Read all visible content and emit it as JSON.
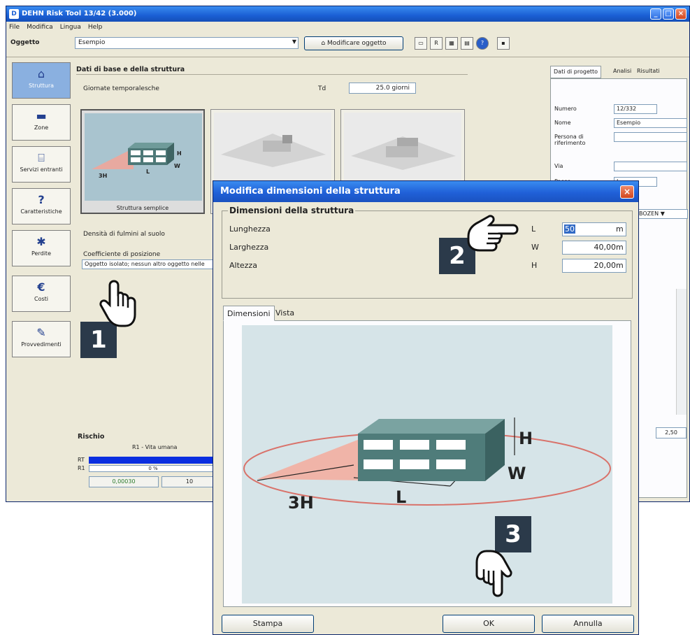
{
  "main_window": {
    "title": "DEHN Risk Tool 13/42 (3.000)",
    "menu": [
      "File",
      "Modifica",
      "Lingua",
      "Help"
    ],
    "object_label": "Oggetto",
    "object_value": "Esempio",
    "modify_object_button": "Modificare oggetto",
    "toolbar_icons": [
      "new-object-icon",
      "re-icon",
      "table-icon",
      "chart-icon",
      "help-icon",
      "save-icon"
    ]
  },
  "sidebar": {
    "items": [
      {
        "label": "Struttura",
        "icon": "building-icon",
        "active": true
      },
      {
        "label": "Zone",
        "icon": "zone-icon"
      },
      {
        "label": "Servizi entranti",
        "icon": "services-icon"
      },
      {
        "label": "Caratteristiche",
        "icon": "question-icon"
      },
      {
        "label": "Perdite",
        "icon": "loss-icon"
      },
      {
        "label": "Costi",
        "icon": "euro-icon"
      },
      {
        "label": "Provvedimenti",
        "icon": "wrench-icon"
      }
    ]
  },
  "base_data": {
    "title": "Dati di base e della struttura",
    "thunderstorm_label": "Giornate temporalesche",
    "td_label": "Td",
    "td_value": "25.0 giorni",
    "card1_caption": "Struttura semplice",
    "flash_density_label": "Densità di fulmini al suolo",
    "position_coeff_label": "Coefficiente di posizione",
    "position_coeff_value": "Oggetto isolato; nessun altro oggetto nelle"
  },
  "risk": {
    "title": "Rischio",
    "r1_label": "R1 - Vita umana",
    "rt": "RT",
    "r1": "R1",
    "percent": "0 %",
    "value": "0,00030",
    "value2": "10"
  },
  "right_panel": {
    "tabs": [
      "Dati di progetto",
      "Analisi",
      "Risultati"
    ],
    "fields": [
      {
        "label": "Numero",
        "value": "12/332"
      },
      {
        "label": "Nome",
        "value": "Esempio"
      },
      {
        "label": "Persona di riferimento",
        "value": ""
      },
      {
        "label": "Via",
        "value": ""
      },
      {
        "label": "Paese",
        "value": "I"
      }
    ],
    "region": "BOZEN",
    "bottom_value": "2,50"
  },
  "dialog": {
    "title": "Modifica dimensioni della struttura",
    "group_title": "Dimensioni della struttura",
    "rows": [
      {
        "name": "Lunghezza",
        "symbol": "L",
        "value": "50",
        "unit": "m"
      },
      {
        "name": "Larghezza",
        "symbol": "W",
        "value": "40,00",
        "unit": "m"
      },
      {
        "name": "Altezza",
        "symbol": "H",
        "value": "20,00",
        "unit": "m"
      }
    ],
    "tabs": [
      "Dimensioni",
      "Vista"
    ],
    "diagram_labels": {
      "h": "H",
      "w": "W",
      "l": "L",
      "three_h": "3H"
    },
    "buttons": {
      "print": "Stampa",
      "ok": "OK",
      "cancel": "Annulla"
    }
  },
  "callouts": [
    "1",
    "2",
    "3"
  ]
}
